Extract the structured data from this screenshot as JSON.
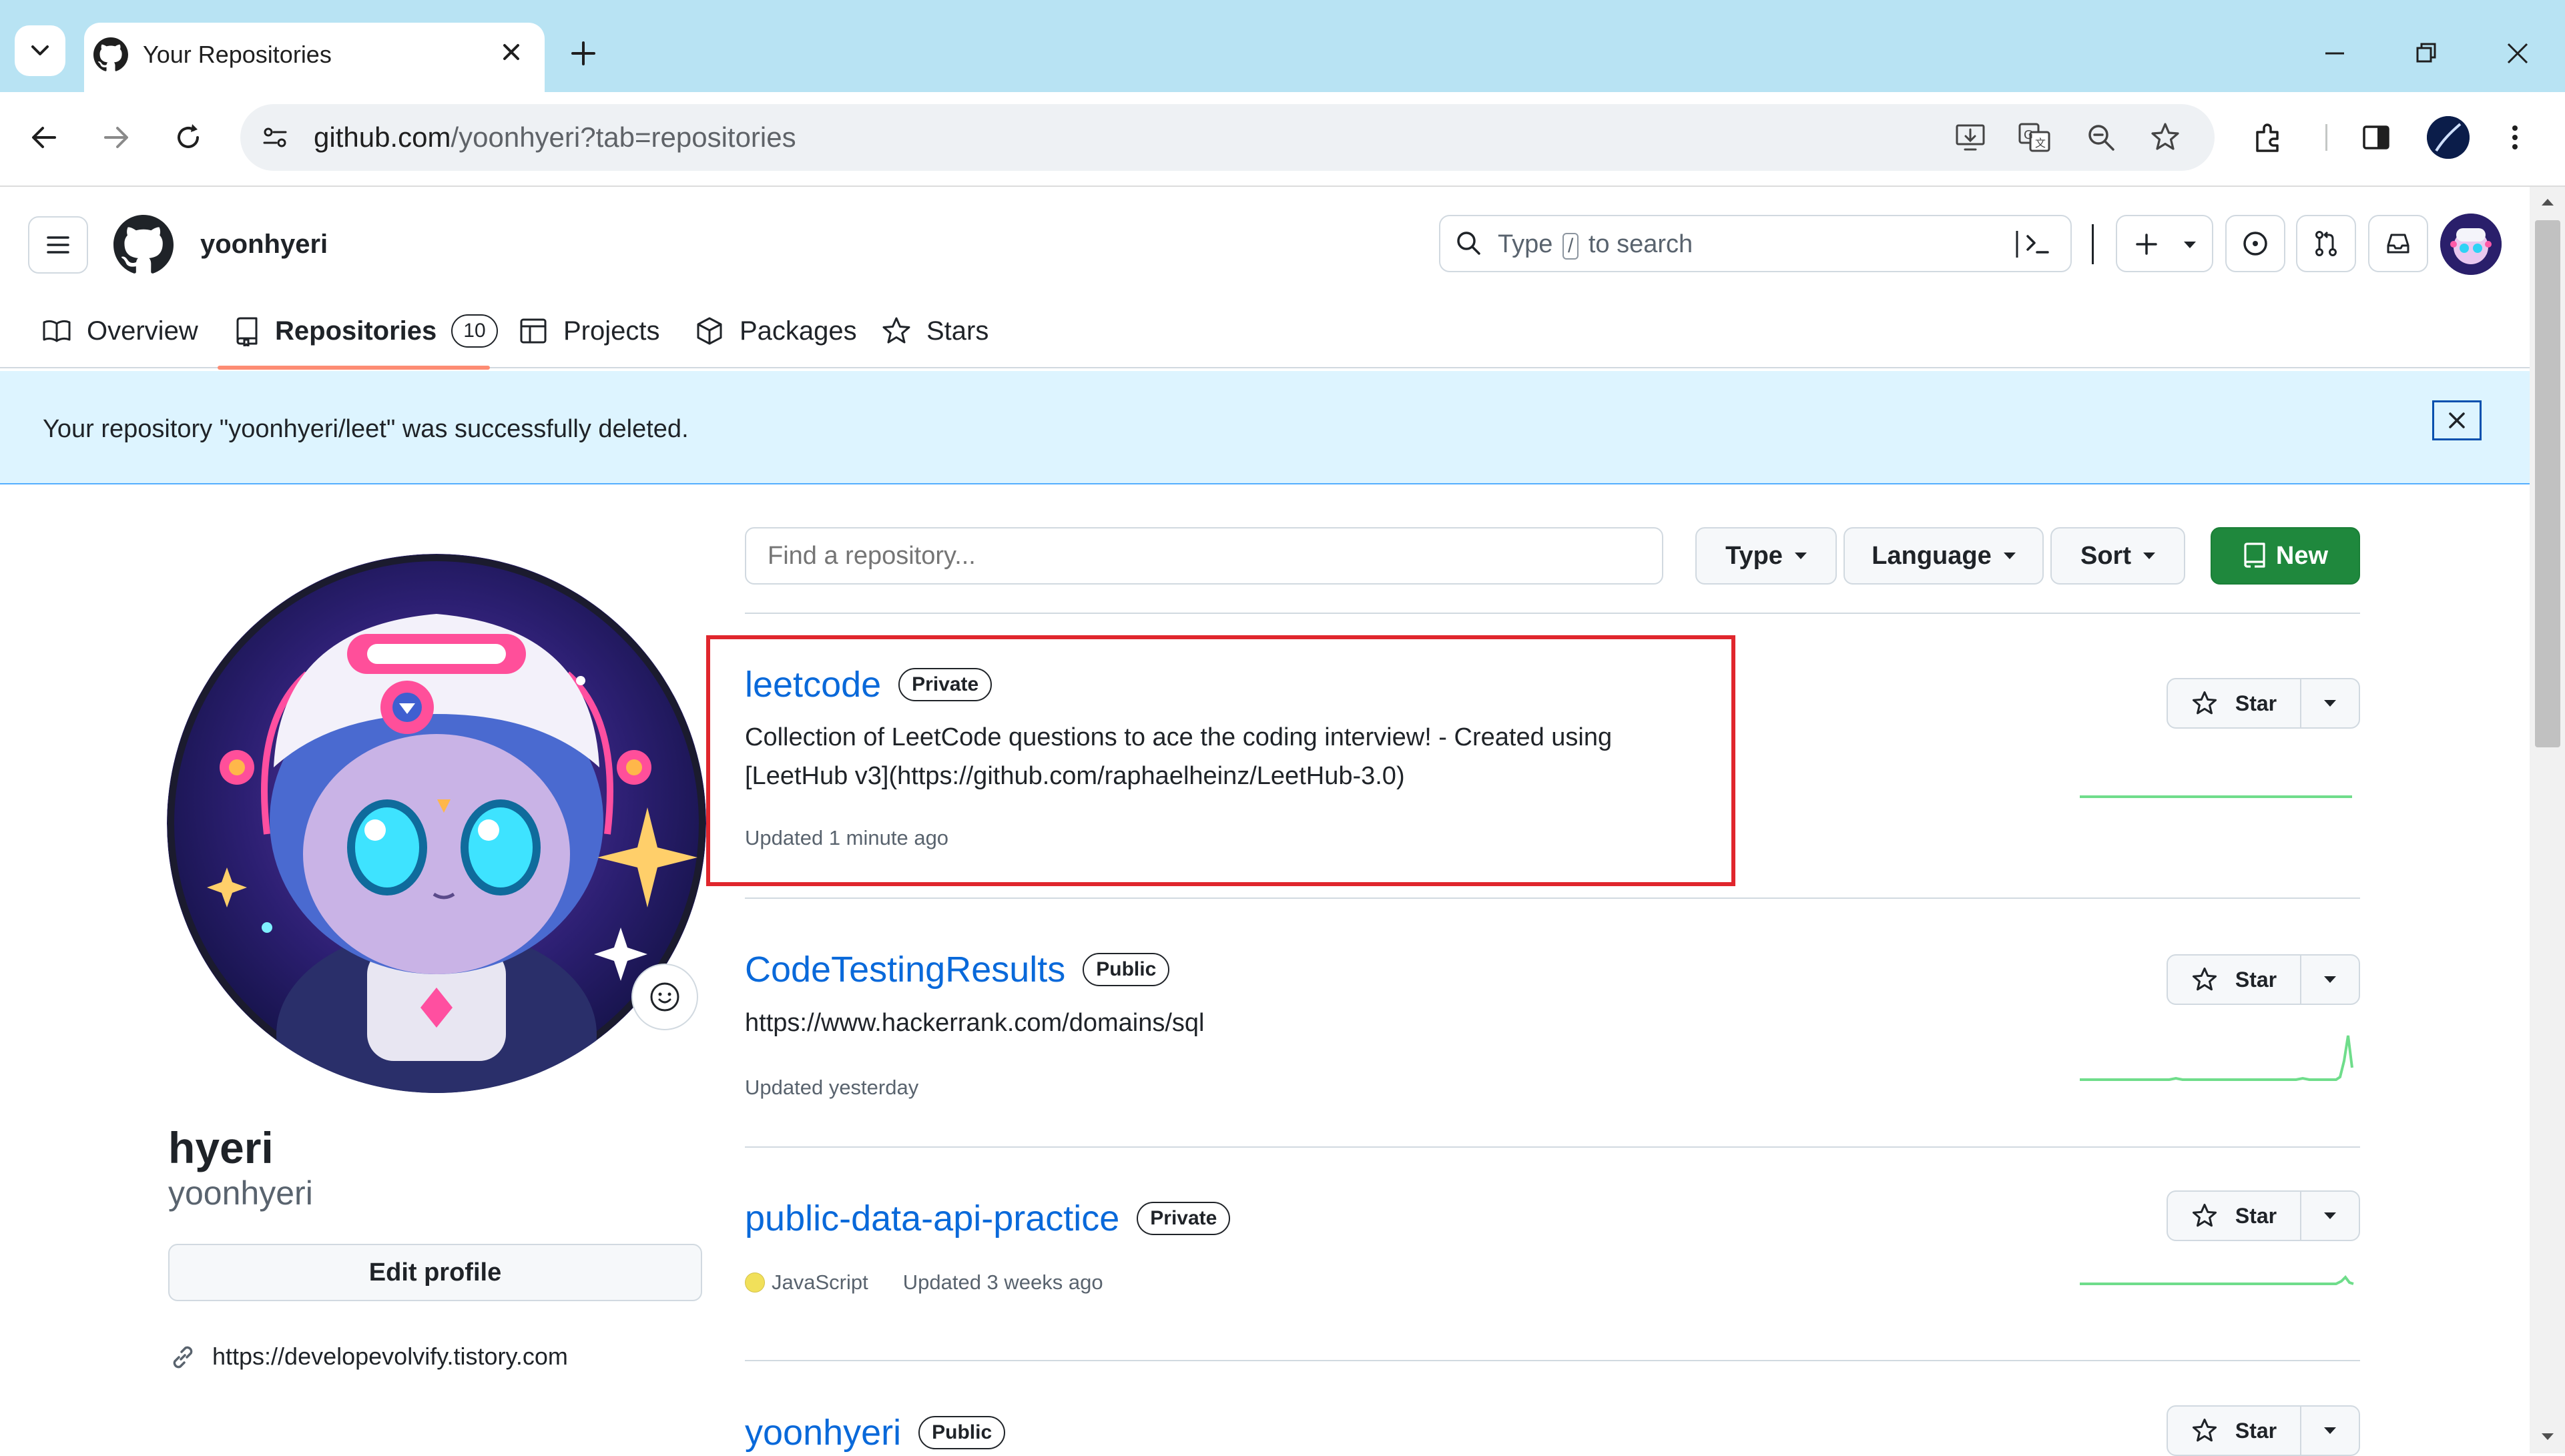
{
  "browser": {
    "tab_title": "Your Repositories",
    "url_host": "github.com",
    "url_path": "/yoonhyeri?tab=repositories"
  },
  "header": {
    "username": "yoonhyeri",
    "search_placeholder_pre": "Type",
    "search_key": "/",
    "search_placeholder_post": "to search"
  },
  "nav": {
    "tabs": [
      {
        "label": "Overview",
        "icon": "book-icon"
      },
      {
        "label": "Repositories",
        "icon": "repo-icon",
        "count": "10",
        "selected": true
      },
      {
        "label": "Projects",
        "icon": "table-icon"
      },
      {
        "label": "Packages",
        "icon": "package-icon"
      },
      {
        "label": "Stars",
        "icon": "star-icon"
      }
    ]
  },
  "flash": {
    "message": "Your repository \"yoonhyeri/leet\" was successfully deleted."
  },
  "profile": {
    "display_name": "hyeri",
    "login": "yoonhyeri",
    "edit_label": "Edit profile",
    "website": "https://developevolvify.tistory.com"
  },
  "filters": {
    "search_placeholder": "Find a repository...",
    "type_label": "Type",
    "language_label": "Language",
    "sort_label": "Sort",
    "new_label": "New"
  },
  "repos": [
    {
      "name": "leetcode",
      "visibility": "Private",
      "description_line1": "Collection of LeetCode questions to ace the coding interview! - Created using",
      "description_line2": "[LeetHub v3](https://github.com/raphaelheinz/LeetHub-3.0)",
      "updated": "Updated 1 minute ago",
      "star_label": "Star"
    },
    {
      "name": "CodeTestingResults",
      "visibility": "Public",
      "description_line1": "https://www.hackerrank.com/domains/sql",
      "updated": "Updated yesterday",
      "star_label": "Star"
    },
    {
      "name": "public-data-api-practice",
      "visibility": "Private",
      "language": "JavaScript",
      "updated": "Updated 3 weeks ago",
      "star_label": "Star"
    },
    {
      "name": "yoonhyeri",
      "visibility": "Public",
      "star_label": "Star"
    }
  ],
  "colors": {
    "accent_link": "#0969da",
    "primary_button": "#1f883d",
    "flash_bg": "#ddf4ff",
    "highlight_border": "#e0262d",
    "tab_underline": "#fd8c73",
    "javascript": "#f1e05a"
  }
}
